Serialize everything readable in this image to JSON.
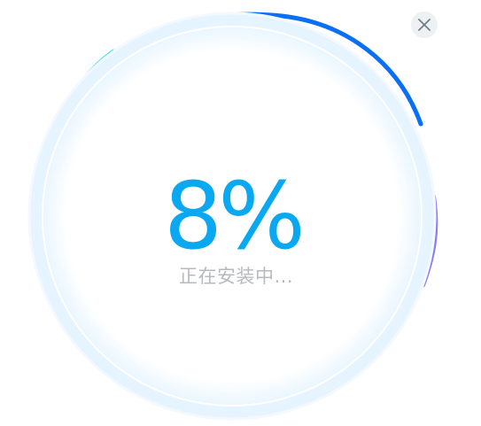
{
  "installer": {
    "progress_percent": 8,
    "progress_text": "8%",
    "status_text": "正在安装中..."
  },
  "close_button": {
    "icon": "close-icon"
  },
  "colors": {
    "progress_text": "#0aa8f0",
    "status_text": "#b7babd",
    "ring_blue": "#0b6ff5",
    "ring_cyan": "#3fe4ff",
    "ring_violet": "#8a7df3",
    "ring_pale": "#e6f4ff",
    "close_bg": "#eef1f3",
    "close_glyph": "#6d8088"
  }
}
